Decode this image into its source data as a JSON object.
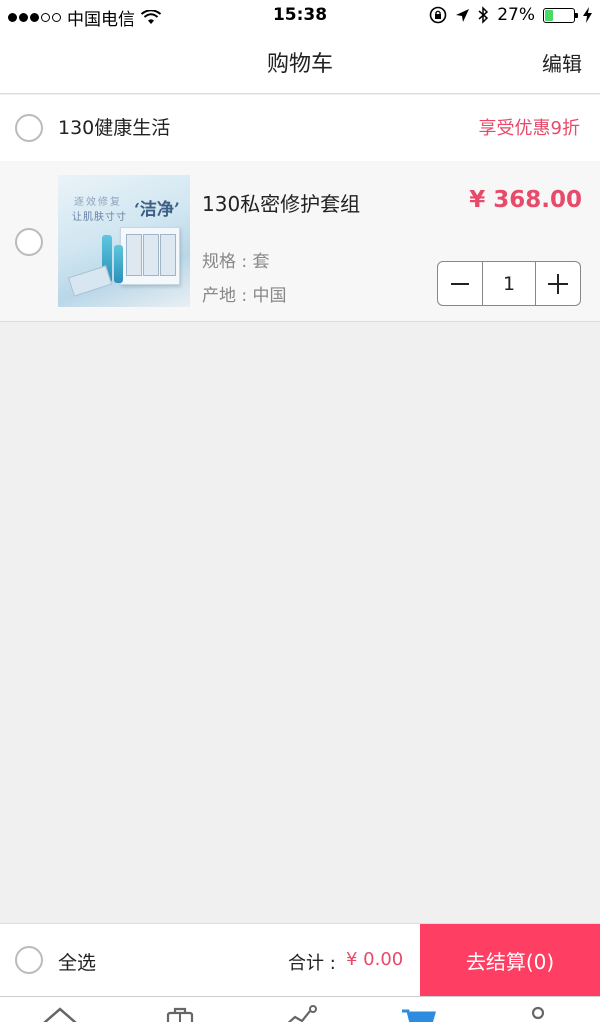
{
  "status_bar": {
    "carrier": "中国电信",
    "time": "15:38",
    "battery": "27%",
    "battery_level": 0.27
  },
  "nav": {
    "title": "购物车",
    "edit_label": "编辑"
  },
  "store": {
    "name": "130健康生活",
    "discount": "享受优惠9折"
  },
  "product": {
    "name": "130私密修护套组",
    "price": "¥ 368.00",
    "spec": "规格 : 套",
    "origin": "产地 : 中国",
    "quantity": "1",
    "image_text": {
      "line1": "逐效修复",
      "line2": "让肌肤寸寸",
      "highlight": "‘洁净’"
    }
  },
  "checkout": {
    "select_all_label": "全选",
    "total_label": "合计 :",
    "total_value": "¥ 0.00",
    "button_label": "去结算(0)"
  },
  "tabs": [
    "home-icon",
    "bag-icon",
    "trend-icon",
    "cart-icon",
    "user-icon"
  ],
  "colors": {
    "accent": "#fe3e62",
    "price": "#e84a6a",
    "active_tab": "#2d8be0"
  }
}
